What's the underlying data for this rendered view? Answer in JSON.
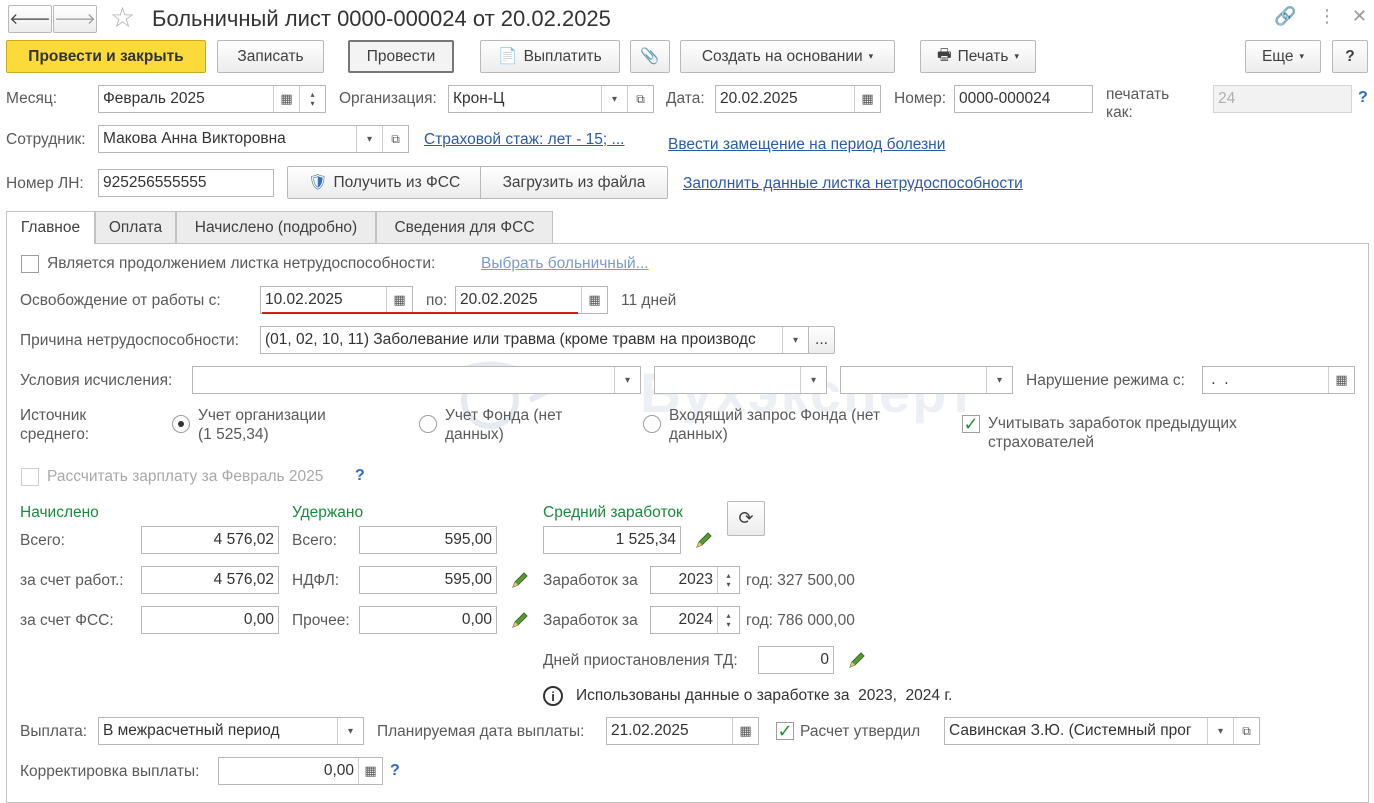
{
  "window": {
    "title": "Больничный лист 0000-000024 от 20.02.2025"
  },
  "toolbar": {
    "post_close": "Провести и закрыть",
    "save": "Записать",
    "post": "Провести",
    "pay": "Выплатить",
    "create_based": "Создать на основании",
    "print": "Печать",
    "more": "Еще",
    "help": "?"
  },
  "header": {
    "month_label": "Месяц:",
    "month_value": "Февраль 2025",
    "org_label": "Организация:",
    "org_value": "Крон-Ц",
    "date_label": "Дата:",
    "date_value": "20.02.2025",
    "number_label": "Номер:",
    "number_value": "0000-000024",
    "print_as_label_1": "печатать",
    "print_as_label_2": "как:",
    "print_as_value": "24",
    "employee_label": "Сотрудник:",
    "employee_value": "Макова Анна Викторовна",
    "insurance_link": "Страховой стаж: лет - 15; ...",
    "replacement_link": "Ввести замещение на период болезни",
    "ln_label": "Номер ЛН:",
    "ln_value": "925256555555",
    "get_fss": "Получить из ФСС",
    "load_file": "Загрузить из файла",
    "fill_link": "Заполнить данные листка нетрудоспособности"
  },
  "tabs": [
    "Главное",
    "Оплата",
    "Начислено (подробно)",
    "Сведения для ФСС"
  ],
  "main": {
    "continuation_label": "Является продолжением листка нетрудоспособности:",
    "choose_link": "Выбрать больничный...",
    "release_label": "Освобождение от работы с:",
    "release_from": "10.02.2025",
    "release_to_label": "по:",
    "release_to": "20.02.2025",
    "days": "11 дней",
    "reason_label": "Причина нетрудоспособности:",
    "reason_value": "(01, 02, 10, 11) Заболевание или травма (кроме травм на производс",
    "reason_more": "...",
    "calc_label": "Условия исчисления:",
    "calc_value1": "",
    "calc_value2": "",
    "calc_value3": "",
    "violation_label": "Нарушение режима с:",
    "violation_value": " .  . ",
    "source_label_1": "Источник",
    "source_label_2": "среднего:",
    "radio1_line1": "Учет организации",
    "radio1_line2": "(1 525,34)",
    "radio2_line1": "Учет Фонда (нет",
    "radio2_line2": "данных)",
    "radio3_line1": "Входящий запрос Фонда (нет",
    "radio3_line2": "данных)",
    "prev_insurers_line1": "Учитывать заработок предыдущих",
    "prev_insurers_line2": "страхователей",
    "calc_salary_label": "Рассчитать зарплату за Февраль 2025",
    "help": "?"
  },
  "accrued": {
    "title": "Начислено",
    "total_label": "Всего:",
    "total": "4 576,02",
    "employer_label": "за счет работ.:",
    "employer": "4 576,02",
    "fss_label": "за счет ФСС:",
    "fss": "0,00"
  },
  "withheld": {
    "title": "Удержано",
    "total_label": "Всего:",
    "total": "595,00",
    "ndfl_label": "НДФЛ:",
    "ndfl": "595,00",
    "other_label": "Прочее:",
    "other": "0,00"
  },
  "average": {
    "title": "Средний заработок",
    "value": "1 525,34",
    "earn_label": "Заработок за",
    "year1": "2023",
    "year1_text": "год: 327 500,00",
    "year2": "2024",
    "year2_text": "год: 786 000,00",
    "suspend_label": "Дней приостановления ТД:",
    "suspend_value": "0",
    "info_text": "Использованы данные о заработке за  2023,  2024 г."
  },
  "payment": {
    "pay_label": "Выплата:",
    "pay_value": "В межрасчетный период",
    "plan_label": "Планируемая дата выплаты:",
    "plan_value": "21.02.2025",
    "approved_label": "Расчет утвердил",
    "approved_value": "Савинская З.Ю. (Системный прог",
    "adjust_label": "Корректировка выплаты:",
    "adjust_value": "0,00",
    "help": "?"
  },
  "watermark": "Бухэксперт",
  "colors": {
    "primary_button": "#fbdb3a",
    "link": "#2d5aa8",
    "section_title": "#1a8a3a",
    "red_underline": "#d21b1b"
  }
}
